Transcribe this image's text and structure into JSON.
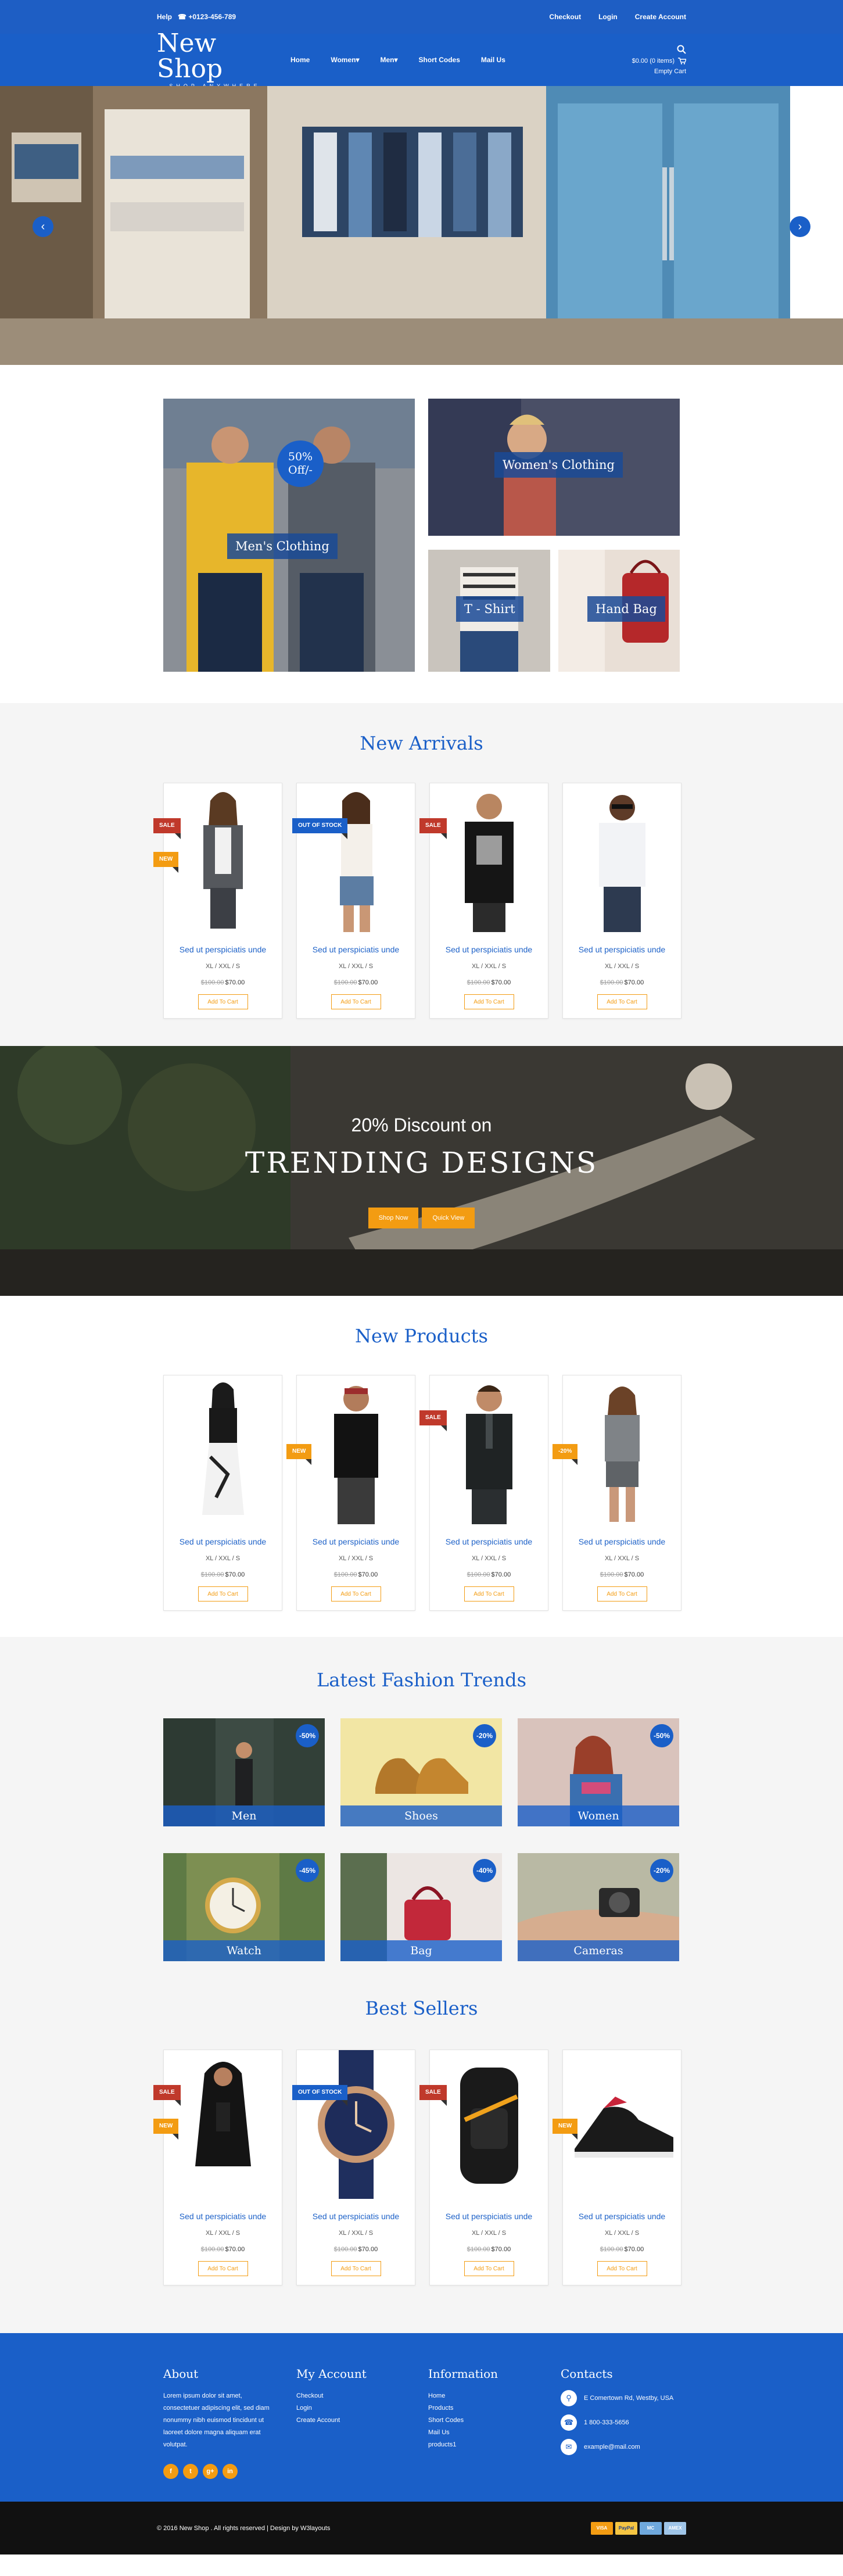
{
  "topbar": {
    "help": "Help",
    "phone": "+0123-456-789",
    "links": [
      "Checkout",
      "Login",
      "Create Account"
    ]
  },
  "nav": {
    "logo_title": "New Shop",
    "logo_sub": "SHOP ANYWHERE",
    "menu": [
      "Home",
      "Women",
      "Men",
      "Short Codes",
      "Mail Us"
    ],
    "cart_total": "$0.00 (0 items)",
    "cart_status": "Empty Cart"
  },
  "categories": {
    "mens": "Men's Clothing",
    "womens": "Women's Clothing",
    "tshirt": "T - Shirt",
    "handbag": "Hand Bag",
    "offer_line1": "50%",
    "offer_line2": "Off/-"
  },
  "product_common": {
    "name": "Sed ut perspiciatis unde",
    "sizes": "XL / XXL / S",
    "old_price": "$100.00",
    "price": "$70.00",
    "button": "Add To Cart"
  },
  "new_arrivals": {
    "title": "New Arrivals",
    "products": [
      {
        "tags": [
          {
            "text": "SALE",
            "color": "red"
          },
          {
            "text": "NEW",
            "color": "orange"
          }
        ]
      },
      {
        "tags": [
          {
            "text": "OUT OF STOCK",
            "color": "blue"
          }
        ]
      },
      {
        "tags": [
          {
            "text": "SALE",
            "color": "red"
          }
        ]
      },
      {
        "tags": []
      }
    ]
  },
  "banner": {
    "sub": "20% Discount on",
    "title": "TRENDING DESIGNS",
    "shop_now": "Shop Now",
    "quick_view": "Quick View"
  },
  "new_products": {
    "title": "New Products",
    "products": [
      {
        "tags": []
      },
      {
        "tags": [
          {
            "text": "NEW",
            "color": "orange"
          }
        ]
      },
      {
        "tags": [
          {
            "text": "SALE",
            "color": "red"
          }
        ]
      },
      {
        "tags": [
          {
            "text": "-20%",
            "color": "orange"
          }
        ]
      }
    ]
  },
  "trends": {
    "title": "Latest Fashion Trends",
    "items": [
      {
        "label": "Men",
        "badge": "-50%"
      },
      {
        "label": "Shoes",
        "badge": "-20%"
      },
      {
        "label": "Women",
        "badge": "-50%"
      },
      {
        "label": "Watch",
        "badge": "-45%"
      },
      {
        "label": "Bag",
        "badge": "-40%"
      },
      {
        "label": "Cameras",
        "badge": "-20%"
      }
    ]
  },
  "best_sellers": {
    "title": "Best Sellers",
    "products": [
      {
        "tags": [
          {
            "text": "SALE",
            "color": "red"
          },
          {
            "text": "NEW",
            "color": "orange"
          }
        ]
      },
      {
        "tags": [
          {
            "text": "OUT OF STOCK",
            "color": "blue"
          }
        ]
      },
      {
        "tags": [
          {
            "text": "SALE",
            "color": "red"
          }
        ]
      },
      {
        "tags": [
          {
            "text": "NEW",
            "color": "orange"
          }
        ]
      }
    ]
  },
  "footer": {
    "about_title": "About",
    "about_text": "Lorem ipsum dolor sit amet, consectetuer adipiscing elit, sed diam nonummy nibh euismod tincidunt ut laoreet dolore magna aliquam erat volutpat.",
    "social": [
      "f",
      "t",
      "g+",
      "in"
    ],
    "account_title": "My Account",
    "account_links": [
      "Checkout",
      "Login",
      "Create Account"
    ],
    "info_title": "Information",
    "info_links": [
      "Home",
      "Products",
      "Short Codes",
      "Mail Us",
      "products1"
    ],
    "contacts_title": "Contacts",
    "address": "E Comertown Rd, Westby, USA",
    "phone": "1 800-333-5656",
    "email": "example@mail.com",
    "copyright": "© 2016 New Shop . All rights reserved | Design by  W3layouts",
    "payments": [
      "VISA",
      "PayPal",
      "MC",
      "AMEX"
    ]
  },
  "colors": {
    "primary": "#1a5fc8",
    "accent": "#f39c12",
    "sale": "#c0392b",
    "dark": "#111111"
  }
}
